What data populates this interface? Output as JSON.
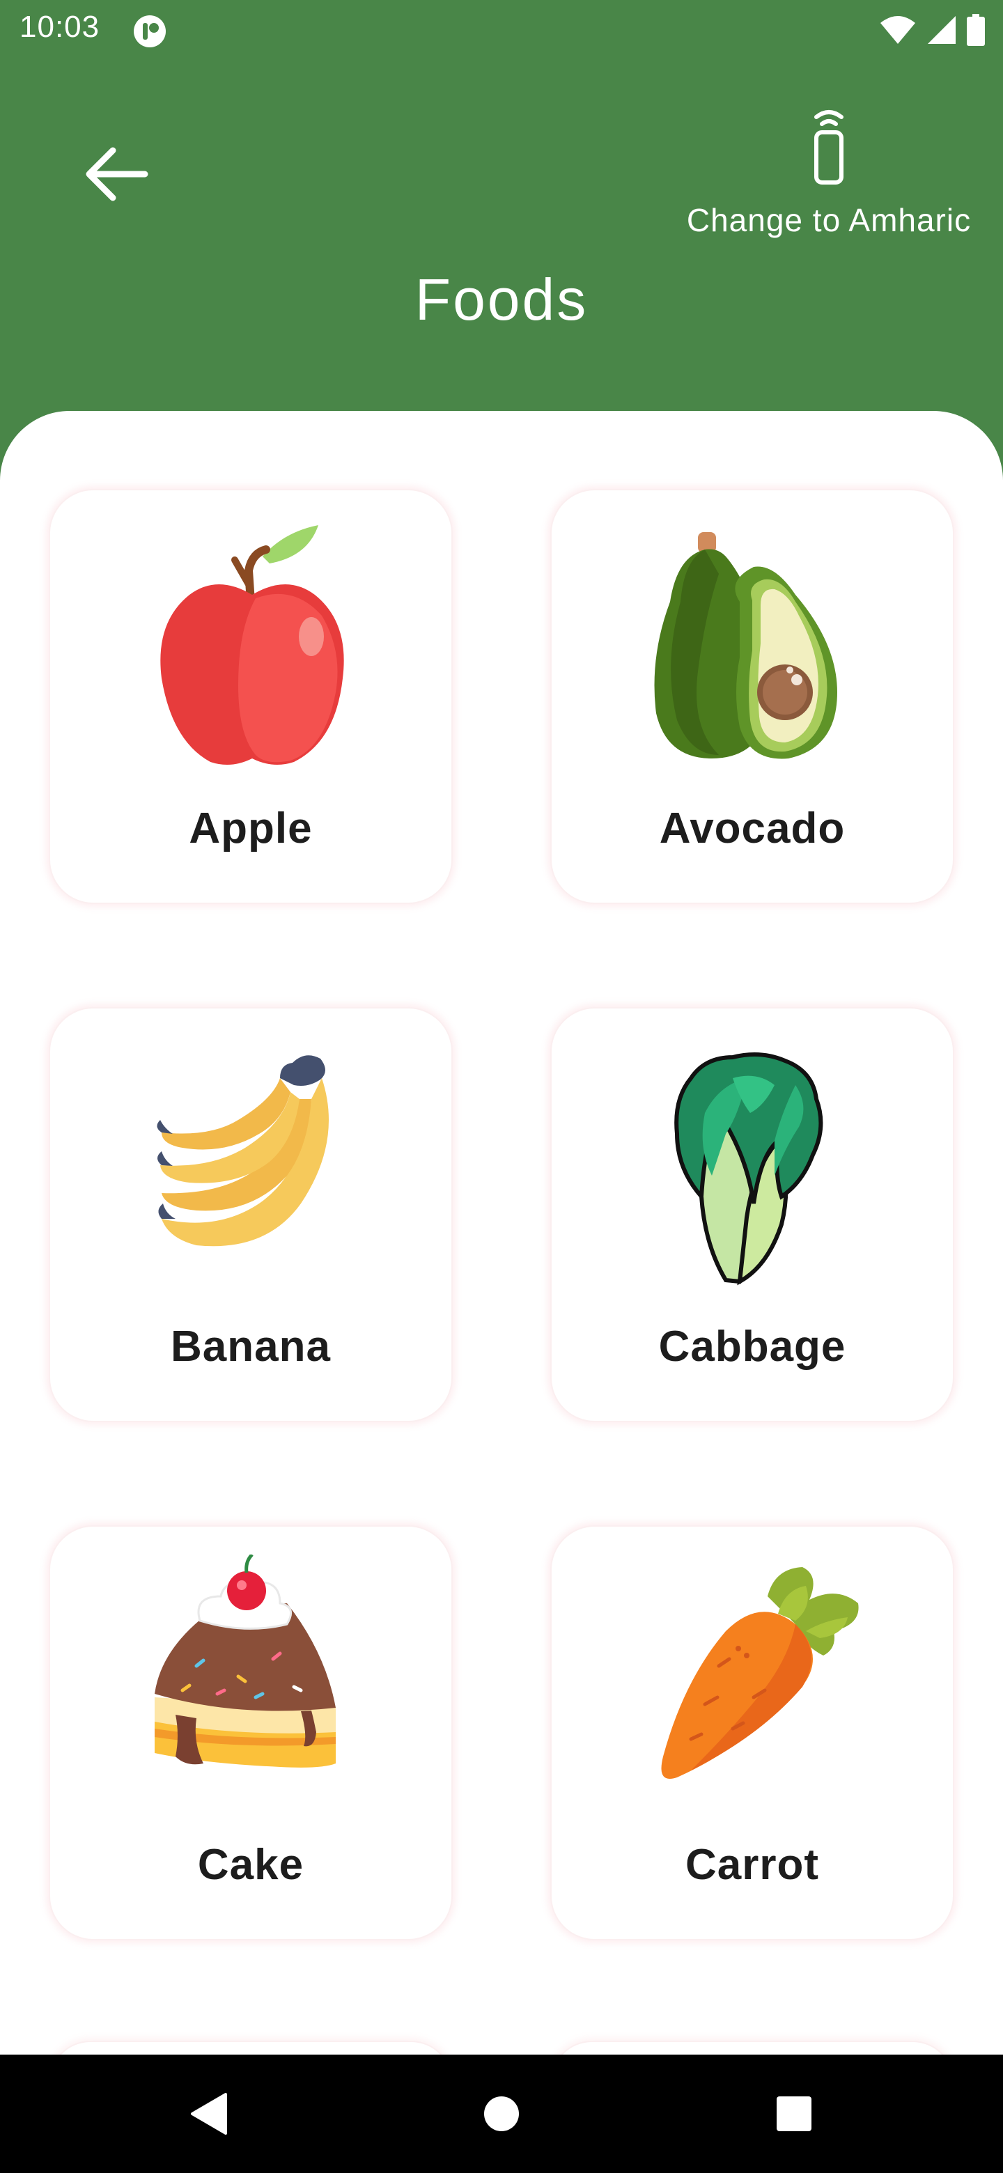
{
  "status_bar": {
    "time": "10:03",
    "icons": [
      "app-notification-icon",
      "wifi-icon",
      "cellular-signal-icon",
      "battery-icon"
    ]
  },
  "header": {
    "title": "Foods",
    "language_toggle_label": "Change to Amharic",
    "background_color": "#498648"
  },
  "foods": [
    {
      "label": "Apple",
      "icon": "apple-icon"
    },
    {
      "label": "Avocado",
      "icon": "avocado-icon"
    },
    {
      "label": "Banana",
      "icon": "banana-icon"
    },
    {
      "label": "Cabbage",
      "icon": "cabbage-icon"
    },
    {
      "label": "Cake",
      "icon": "cake-icon"
    },
    {
      "label": "Carrot",
      "icon": "carrot-icon"
    }
  ],
  "nav_bar": {
    "buttons": [
      "back-triangle-icon",
      "home-circle-icon",
      "recents-square-icon"
    ]
  }
}
